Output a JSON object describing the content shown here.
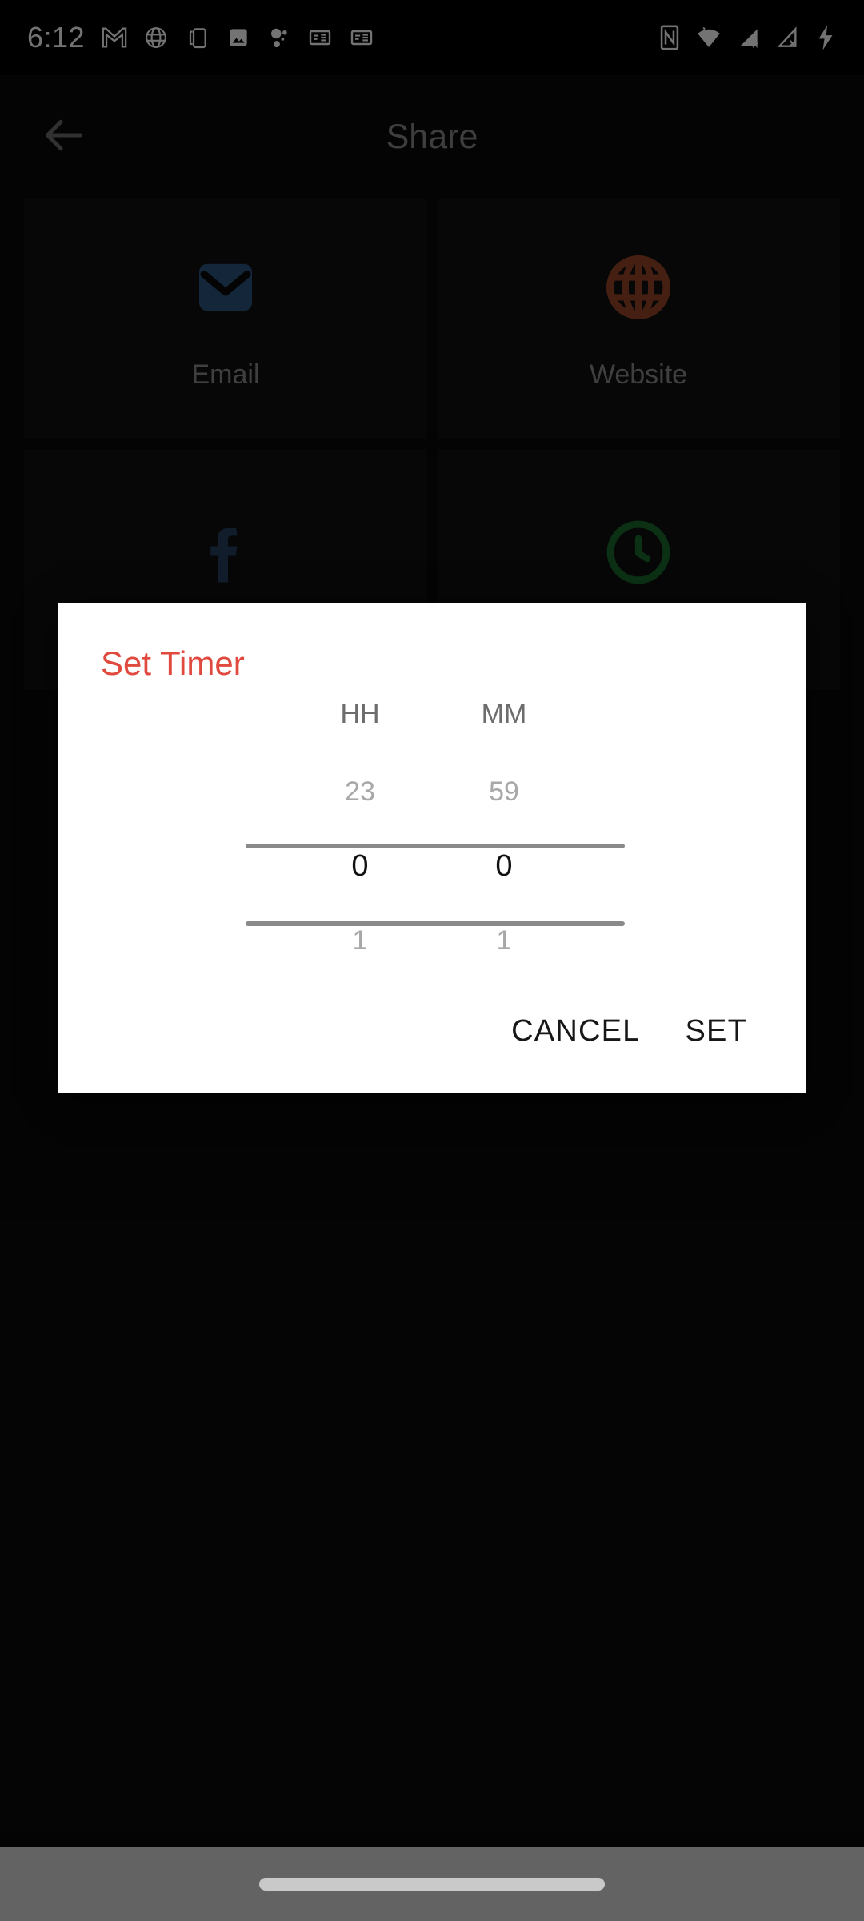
{
  "status_bar": {
    "time": "6:12",
    "left_icons": [
      "gmail-icon",
      "globe-icon",
      "screen-mirror-icon",
      "photos-icon",
      "bubbles-icon",
      "news-icon",
      "news-icon"
    ],
    "right_icons": [
      "nfc-icon",
      "wifi-icon",
      "signal-roaming-icon",
      "signal-no-sim-icon",
      "charging-bolt-icon"
    ]
  },
  "app": {
    "back_icon": "arrow-left-icon",
    "title": "Share",
    "cards": [
      {
        "label": "Email",
        "icon": "envelope-icon",
        "color": "#2e5481"
      },
      {
        "label": "Website",
        "icon": "globe-icon",
        "color": "#9c452a"
      },
      {
        "label": "",
        "icon": "facebook-icon",
        "color": "#27405f"
      },
      {
        "label": "",
        "icon": "whatsapp-icon",
        "color": "#1a6b2e"
      }
    ]
  },
  "dialog": {
    "title": "Set Timer",
    "title_color": "#e04a3e",
    "columns": [
      {
        "header": "HH",
        "previous": "23",
        "selected": "0",
        "next": "1"
      },
      {
        "header": "MM",
        "previous": "59",
        "selected": "0",
        "next": "1"
      }
    ],
    "buttons": {
      "cancel": "CANCEL",
      "set": "SET"
    }
  },
  "nav_bar": {
    "home_indicator": "home-pill"
  }
}
